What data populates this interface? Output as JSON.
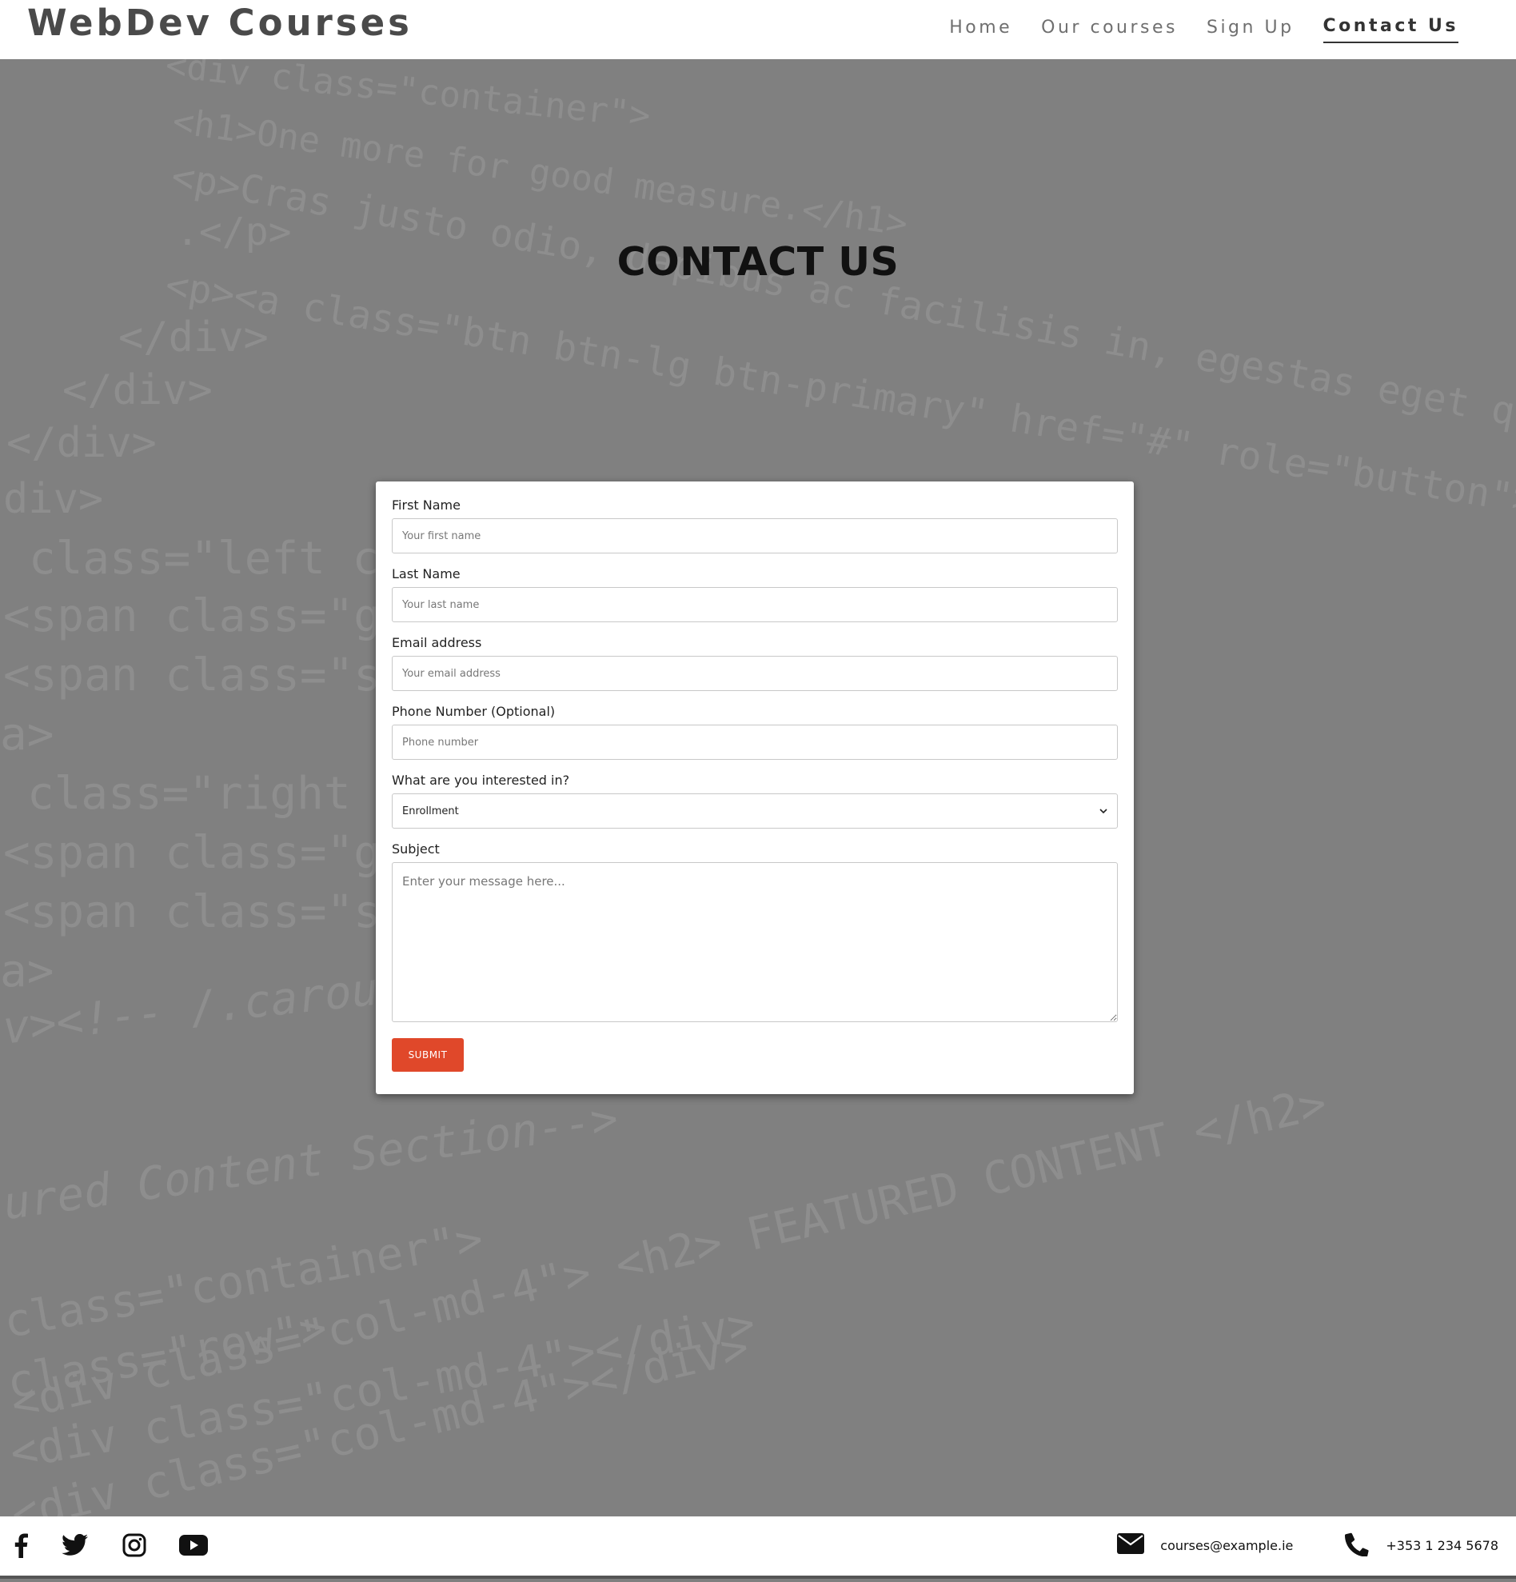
{
  "brand": "WebDev Courses",
  "nav": [
    {
      "label": "Home"
    },
    {
      "label": "Our courses"
    },
    {
      "label": "Sign Up"
    },
    {
      "label": "Contact Us"
    }
  ],
  "page_title": "CONTACT US",
  "background_code": [
    "<div class=\"container\">",
    "<h1>One more for good measure.</h1>",
    "<p>Cras justo odio, dapibus ac facilisis in, egestas eget quam.",
    ".</p>",
    "<p><a class=\"btn btn-lg btn-primary\" href=\"#\" role=\"button\">Browse gallery</a>",
    "</div>",
    "</div>",
    "</div>",
    "div>",
    "class=\"left carousel-control\"",
    "<span class=\"glyphicon\"",
    "<span class=\"sr-only\"",
    "a>",
    "class=\"right carousel-control\"",
    "<span class=\"glyphicon\"",
    "<span class=\"sr-only\"",
    "a>",
    "v><!-- /.carousel -->",
    "ured Content Section-->",
    "class=\"container\">",
    "class=\"row\">",
    "<div class=\"col-md-4\"></div>",
    "<div class=\"col-md-4\"> <h2> FEATURED CONTENT </h2>",
    "<div class=\"col-md-4\"></div>"
  ],
  "form": {
    "first_name": {
      "label": "First Name",
      "placeholder": "Your first name"
    },
    "last_name": {
      "label": "Last Name",
      "placeholder": "Your last name"
    },
    "email": {
      "label": "Email address",
      "placeholder": "Your email address"
    },
    "phone": {
      "label": "Phone Number (Optional)",
      "placeholder": "Phone number"
    },
    "interest": {
      "label": "What are you interested in?",
      "selected": "Enrollment"
    },
    "subject": {
      "label": "Subject",
      "placeholder": "Enter your message here..."
    },
    "submit_label": "SUBMIT"
  },
  "footer": {
    "social_icons": [
      "facebook-icon",
      "twitter-icon",
      "instagram-icon",
      "youtube-icon"
    ],
    "email": "courses@example.ie",
    "phone": "+353 1 234 5678"
  },
  "colors": {
    "accent": "#e0482a",
    "background": "#808080",
    "header": "#ffffff"
  }
}
